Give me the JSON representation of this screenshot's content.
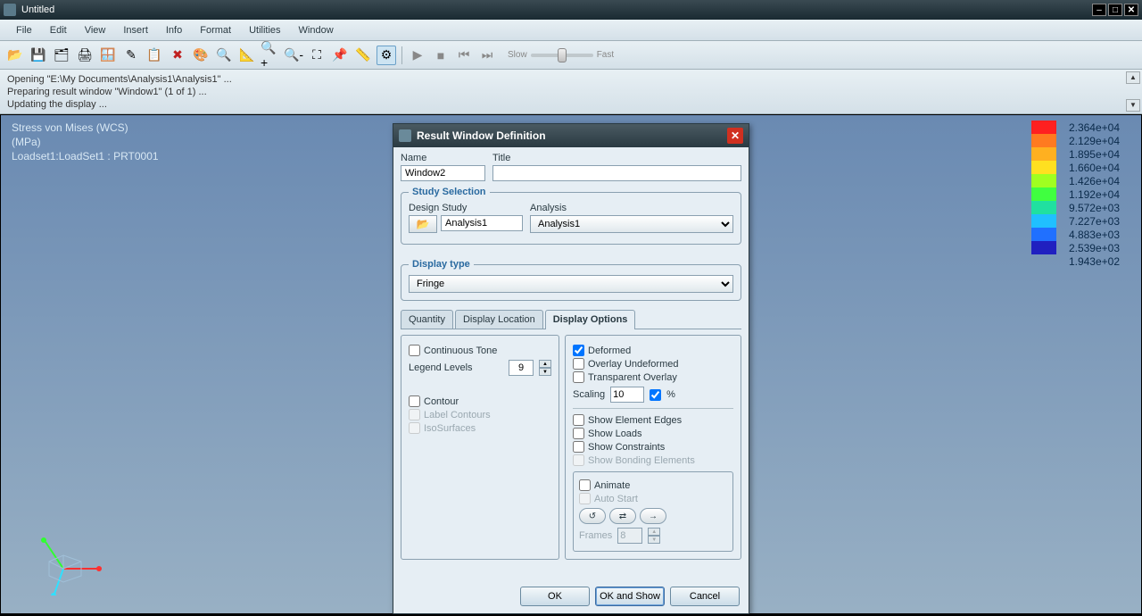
{
  "app": {
    "title": "Untitled"
  },
  "menu": [
    "File",
    "Edit",
    "View",
    "Insert",
    "Info",
    "Format",
    "Utilities",
    "Window"
  ],
  "toolbar": {
    "slow": "Slow",
    "fast": "Fast"
  },
  "log": [
    "Opening \"E:\\My Documents\\Analysis1\\Analysis1\" ...",
    "Preparing result window \"Window1\" (1 of 1) ...",
    "Updating the display ..."
  ],
  "viewport": {
    "line1": "Stress von Mises (WCS)",
    "line2": "(MPa)",
    "line3": "Loadset1:LoadSet1  :  PRT0001"
  },
  "legend": {
    "items": [
      {
        "color": "#ff2020",
        "val": "2.364e+04"
      },
      {
        "color": "#ff7a20",
        "val": "2.129e+04"
      },
      {
        "color": "#ffb020",
        "val": "1.895e+04"
      },
      {
        "color": "#ffe020",
        "val": "1.660e+04"
      },
      {
        "color": "#a0ff20",
        "val": "1.426e+04"
      },
      {
        "color": "#40ff40",
        "val": "1.192e+04"
      },
      {
        "color": "#20e0a0",
        "val": "9.572e+03"
      },
      {
        "color": "#20c0ff",
        "val": "7.227e+03"
      },
      {
        "color": "#2070ff",
        "val": "4.883e+03"
      },
      {
        "color": "#2020c0",
        "val": "2.539e+03"
      }
    ],
    "last": "1.943e+02"
  },
  "dialog": {
    "title": "Result Window Definition",
    "name_label": "Name",
    "title_label": "Title",
    "name_value": "Window2",
    "title_value": "",
    "study_legend": "Study Selection",
    "design_study_label": "Design Study",
    "analysis_label": "Analysis",
    "design_study_value": "Analysis1",
    "analysis_value": "Analysis1",
    "display_type_legend": "Display type",
    "display_type_value": "Fringe",
    "tabs": {
      "quantity": "Quantity",
      "location": "Display Location",
      "options": "Display Options"
    },
    "opts": {
      "continuous_tone": "Continuous Tone",
      "legend_levels": "Legend Levels",
      "legend_levels_value": "9",
      "contour": "Contour",
      "label_contours": "Label Contours",
      "isosurfaces": "IsoSurfaces",
      "deformed": "Deformed",
      "overlay_undeformed": "Overlay Undeformed",
      "transparent_overlay": "Transparent Overlay",
      "scaling": "Scaling",
      "scaling_value": "10",
      "percent": "%",
      "show_element_edges": "Show Element Edges",
      "show_loads": "Show Loads",
      "show_constraints": "Show Constraints",
      "show_bonding": "Show Bonding Elements",
      "animate": "Animate",
      "auto_start": "Auto Start",
      "frames": "Frames",
      "frames_value": "8"
    },
    "buttons": {
      "ok": "OK",
      "ok_show": "OK and Show",
      "cancel": "Cancel"
    }
  }
}
